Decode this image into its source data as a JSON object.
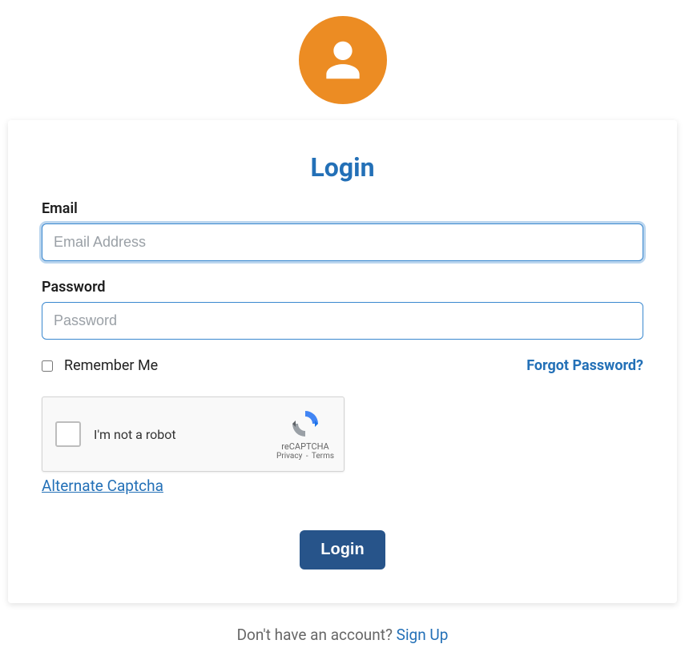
{
  "page": {
    "title": "Login"
  },
  "form": {
    "email_label": "Email",
    "email_placeholder": "Email Address",
    "email_value": "",
    "password_label": "Password",
    "password_placeholder": "Password",
    "password_value": "",
    "remember_label": "Remember Me",
    "forgot_label": "Forgot Password?",
    "submit_label": "Login"
  },
  "captcha": {
    "robot_label": "I'm not a robot",
    "brand": "reCAPTCHA",
    "privacy": "Privacy",
    "terms": "Terms",
    "separator": "-",
    "alt_link": "Alternate Captcha"
  },
  "signup": {
    "prompt": "Don't have an account? ",
    "link": "Sign Up"
  },
  "icons": {
    "avatar": "user-icon"
  },
  "colors": {
    "accent": "#2370b7",
    "avatar_bg": "#ec8c23",
    "button_bg": "#27548a"
  }
}
